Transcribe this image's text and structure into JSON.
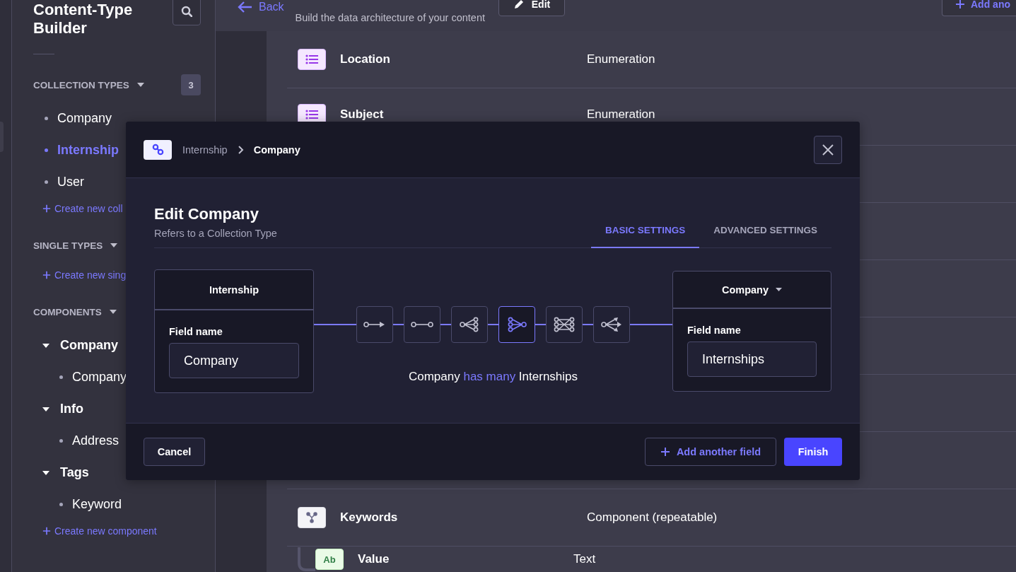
{
  "sidebar": {
    "title": "Content-Type Builder",
    "sections": [
      {
        "label": "COLLECTION TYPES",
        "expanded": true,
        "count": "3",
        "items": [
          {
            "label": "Company",
            "selected": false
          },
          {
            "label": "Internship",
            "selected": true
          },
          {
            "label": "User",
            "selected": false
          }
        ],
        "create_link": "Create new coll"
      },
      {
        "label": "SINGLE TYPES",
        "expanded": true,
        "create_link": "Create new sing"
      },
      {
        "label": "COMPONENTS",
        "expanded": true,
        "items": [
          {
            "label": "Company",
            "expanded": true,
            "children": [
              {
                "label": "Company",
                "selected": false
              }
            ]
          },
          {
            "label": "Info",
            "expanded": true,
            "children": [
              {
                "label": "Address",
                "selected": false
              }
            ]
          },
          {
            "label": "Tags",
            "expanded": true,
            "children": [
              {
                "label": "Keyword",
                "selected": false
              }
            ]
          }
        ],
        "create_link": "Create new component"
      }
    ]
  },
  "header": {
    "back": "Back",
    "subtitle": "Build the data architecture of your content",
    "edit_button": "Edit",
    "add_button": "Add ano"
  },
  "fields": [
    {
      "name": "Location",
      "type": "Enumeration",
      "kind": "enumeration"
    },
    {
      "name": "Subject",
      "type": "Enumeration",
      "kind": "enumeration"
    },
    {
      "name": "Keywords",
      "type": "Component (repeatable)",
      "kind": "component",
      "children": [
        {
          "name": "Value",
          "type": "Text",
          "kind": "text",
          "icon_text": "Ab"
        }
      ]
    }
  ],
  "modal": {
    "breadcrumb": [
      "Internship",
      "Company"
    ],
    "title": "Edit Company",
    "subtitle": "Refers to a Collection Type",
    "tabs": [
      {
        "label": "BASIC SETTINGS",
        "selected": true
      },
      {
        "label": "ADVANCED SETTINGS",
        "selected": false
      }
    ],
    "left": {
      "name": "Internship",
      "field_label": "Field name",
      "value": "Company"
    },
    "right": {
      "name": "Company",
      "dropdown": true,
      "field_label": "Field name",
      "value": "Internships"
    },
    "relations": [
      {
        "kind": "one-way",
        "selected": false
      },
      {
        "kind": "one-to-one",
        "selected": false
      },
      {
        "kind": "one-to-many",
        "selected": false
      },
      {
        "kind": "many-to-one",
        "selected": true
      },
      {
        "kind": "many-to-many",
        "selected": false
      },
      {
        "kind": "many-way",
        "selected": false
      }
    ],
    "summary": {
      "subject": "Company",
      "relation": "has many",
      "object": "Internships"
    },
    "cancel": "Cancel",
    "add_field": "Add another field",
    "finish": "Finish"
  }
}
